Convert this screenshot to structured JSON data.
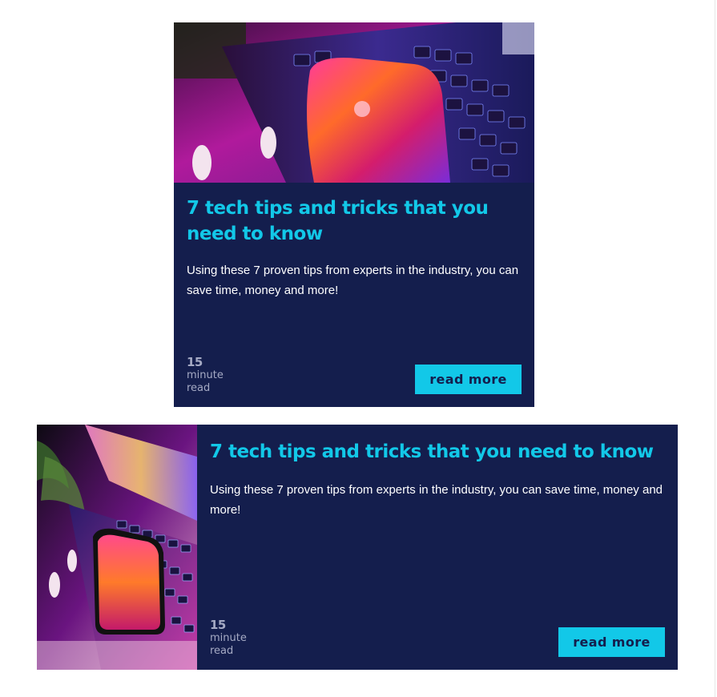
{
  "cards": [
    {
      "title": "7 tech tips and tricks that you need to know",
      "excerpt": "Using these 7 proven tips from experts in the industry, you can save time, money and more!",
      "read_time_number": "15",
      "read_time_unit": "minute",
      "read_time_suffix": "read",
      "button_label": "read more",
      "image": "laptop-phone-photo"
    },
    {
      "title": "7 tech tips and tricks that you need to know",
      "excerpt": "Using these 7 proven tips from experts in the industry, you can save time, money and more!",
      "read_time_number": "15",
      "read_time_unit": "minute",
      "read_time_suffix": "read",
      "button_label": "read more",
      "image": "laptop-phone-photo"
    }
  ],
  "colors": {
    "card_background": "#141e4d",
    "accent": "#12c8e8",
    "text": "#ffffff",
    "muted": "#a5aac4"
  }
}
